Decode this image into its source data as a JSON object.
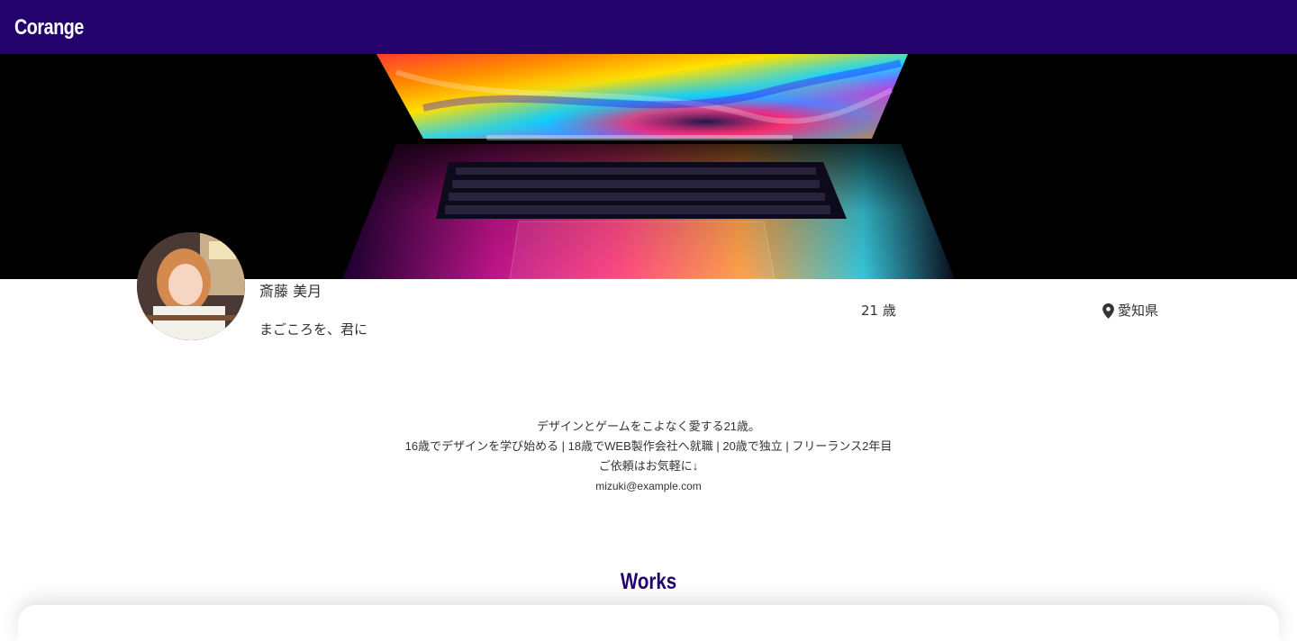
{
  "header": {
    "logo": "Corange",
    "background_color": "#23036b"
  },
  "hero": {
    "image": "laptop-colorful-screen-keyboard"
  },
  "profile": {
    "avatar": "profile-photo",
    "name": "斎藤 美月",
    "tagline": "まごころを、君に",
    "age": "21 歳",
    "location_icon": "map-pin-icon",
    "location": "愛知県"
  },
  "bio": {
    "line1": "デザインとゲームをこよなく愛する21歳。",
    "line2": "16歳でデザインを学び始める | 18歳でWEB製作会社へ就職 | 20歳で独立 | フリーランス2年目",
    "line3": "ご依頼はお気軽に↓",
    "email": "mizuki@example.com"
  },
  "works": {
    "title": "Works",
    "title_color": "#23036b"
  }
}
